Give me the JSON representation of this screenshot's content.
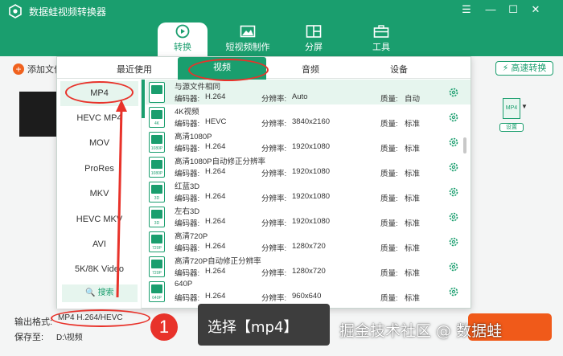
{
  "app": {
    "title": "数据蛙视频转换器"
  },
  "colors": {
    "brand": "#1a9e6e",
    "accent": "#f05a1a",
    "annotation": "#e8322a"
  },
  "window_controls": [
    "☰",
    "—",
    "☐",
    "✕"
  ],
  "nav": [
    {
      "label": "转换",
      "icon": "convert-icon",
      "active": true
    },
    {
      "label": "短视频制作",
      "icon": "photo-icon"
    },
    {
      "label": "分屏",
      "icon": "split-screen-icon"
    },
    {
      "label": "工具",
      "icon": "toolbox-icon"
    }
  ],
  "main": {
    "add_file": "添加文件",
    "fast_convert": "高速转换",
    "format_thumb": "MP4",
    "format_settings": "设置",
    "output_format_label": "输出格式:",
    "output_format_value": "MP4 H.264/HEVC",
    "save_to_label": "保存至:",
    "save_to_value": "D:\\视频"
  },
  "popup": {
    "tabs": [
      "最近使用",
      "视频",
      "音频",
      "设备"
    ],
    "active_tab": "视频",
    "formats": [
      "MP4",
      "HEVC MP4",
      "MOV",
      "ProRes",
      "MKV",
      "HEVC MKV",
      "AVI",
      "5K/8K Video"
    ],
    "active_format": "MP4",
    "search_label": "搜索",
    "detail_labels": {
      "encoder": "编码器:",
      "resolution": "分辨率:",
      "quality": "质量:"
    },
    "presets": [
      {
        "name": "与源文件相同",
        "encoder": "H.264",
        "resolution": "Auto",
        "quality": "自动",
        "icon_text": "",
        "icon": "file-copy-icon"
      },
      {
        "name": "4K视频",
        "encoder": "HEVC",
        "resolution": "3840x2160",
        "quality": "标准",
        "icon_text": "4K",
        "icon": "video-4k-icon"
      },
      {
        "name": "高清1080P",
        "encoder": "H.264",
        "resolution": "1920x1080",
        "quality": "标准",
        "icon_text": "1080P",
        "icon": "video-1080p-icon"
      },
      {
        "name": "高清1080P自动修正分辨率",
        "encoder": "H.264",
        "resolution": "1920x1080",
        "quality": "标准",
        "icon_text": "1080P",
        "icon": "video-1080p-icon"
      },
      {
        "name": "红蓝3D",
        "encoder": "H.264",
        "resolution": "1920x1080",
        "quality": "标准",
        "icon_text": "3D",
        "icon": "video-3d-icon"
      },
      {
        "name": "左右3D",
        "encoder": "H.264",
        "resolution": "1920x1080",
        "quality": "标准",
        "icon_text": "3D",
        "icon": "video-3d-icon"
      },
      {
        "name": "高清720P",
        "encoder": "H.264",
        "resolution": "1280x720",
        "quality": "标准",
        "icon_text": "720P",
        "icon": "video-720p-icon"
      },
      {
        "name": "高清720P自动修正分辨率",
        "encoder": "H.264",
        "resolution": "1280x720",
        "quality": "标准",
        "icon_text": "720P",
        "icon": "video-720p-icon"
      },
      {
        "name": "640P",
        "encoder": "H.264",
        "resolution": "960x640",
        "quality": "标准",
        "icon_text": "640P",
        "icon": "video-640p-icon"
      }
    ]
  },
  "annotation": {
    "step_number": "1",
    "text": "选择【mp4】",
    "watermark": "掘金技术社区 @ 数据蛙"
  }
}
